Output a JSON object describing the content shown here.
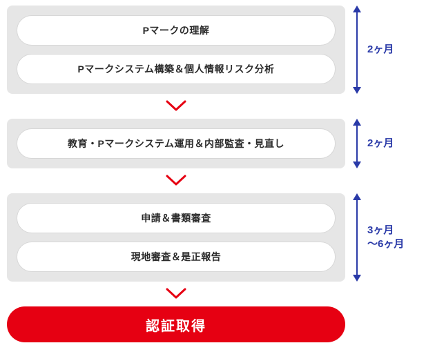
{
  "phases": [
    {
      "steps": [
        "Pマークの理解",
        "Pマークシステム構築＆個人情報リスク分析"
      ],
      "duration": "2ヶ月"
    },
    {
      "steps": [
        "教育・Pマークシステム運用＆内部監査・見直し"
      ],
      "duration": "2ヶ月"
    },
    {
      "steps": [
        "申請＆書類審査",
        "現地審査＆是正報告"
      ],
      "duration": "3ヶ月\n〜6ヶ月"
    }
  ],
  "final": "認証取得",
  "colors": {
    "accent_blue": "#2a3aa8",
    "accent_red": "#e60012",
    "phase_bg": "#e6e6e6"
  }
}
